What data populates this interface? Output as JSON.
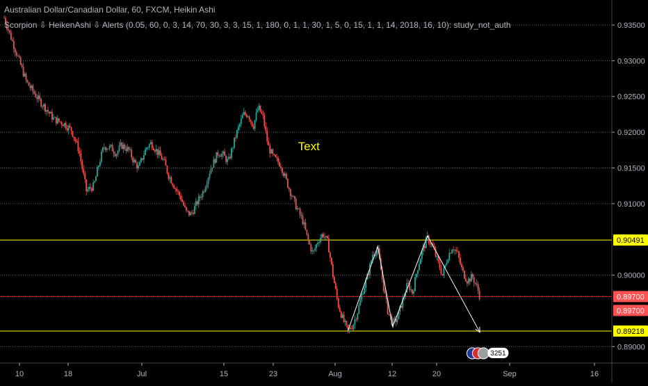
{
  "header": {
    "title": "Australian Dollar/Canadian Dollar, 60, FXCM, Heikin Ashi",
    "study": "Scorpion ⇩ HeikenAshi ⇩ Alerts (0.05, 60, 0, 3, 14, 70, 30, 3, 3, 15, 1, 180, 0, 1, 1, 30, 1, 5, 0, 15, 1, 1, 14, 2018, 16, 10): study_not_auth"
  },
  "colors": {
    "background": "#000000",
    "grid": "#5d606b",
    "axis_text": "#b2b5be",
    "candle_up": "#26a69a",
    "candle_down": "#ef5350",
    "level_yellow": "#ffff00",
    "level_red": "#ff5252",
    "annotation_text": "#ffff00",
    "pattern_line": "#ffffff"
  },
  "chart_data": {
    "type": "candlestick",
    "title": "Australian Dollar/Canadian Dollar, 60, FXCM, Heikin Ashi",
    "xlabel": "",
    "ylabel": "",
    "ylim": [
      0.8877,
      0.9385
    ],
    "y_ticks": [
      "0.93500",
      "0.93000",
      "0.92500",
      "0.92000",
      "0.91500",
      "0.91000",
      "0.90000",
      "0.89000"
    ],
    "x_tick_labels": [
      "10",
      "18",
      "Jul",
      "15",
      "23",
      "Aug",
      "12",
      "20",
      "Sep",
      "16"
    ],
    "grid": true,
    "price_series": [
      {
        "t": 0,
        "p": 0.936
      },
      {
        "t": 2,
        "p": 0.934
      },
      {
        "t": 6,
        "p": 0.93
      },
      {
        "t": 9,
        "p": 0.927
      },
      {
        "t": 12,
        "p": 0.9255
      },
      {
        "t": 14,
        "p": 0.9245
      },
      {
        "t": 17,
        "p": 0.9232
      },
      {
        "t": 20,
        "p": 0.9218
      },
      {
        "t": 24,
        "p": 0.9212
      },
      {
        "t": 27,
        "p": 0.9203
      },
      {
        "t": 30,
        "p": 0.9175
      },
      {
        "t": 33,
        "p": 0.9118
      },
      {
        "t": 36,
        "p": 0.9125
      },
      {
        "t": 38,
        "p": 0.9155
      },
      {
        "t": 40,
        "p": 0.918
      },
      {
        "t": 43,
        "p": 0.9178
      },
      {
        "t": 45,
        "p": 0.917
      },
      {
        "t": 47,
        "p": 0.9182
      },
      {
        "t": 50,
        "p": 0.9175
      },
      {
        "t": 52,
        "p": 0.916
      },
      {
        "t": 54,
        "p": 0.915
      },
      {
        "t": 57,
        "p": 0.9178
      },
      {
        "t": 59,
        "p": 0.9185
      },
      {
        "t": 61,
        "p": 0.9175
      },
      {
        "t": 64,
        "p": 0.916
      },
      {
        "t": 66,
        "p": 0.914
      },
      {
        "t": 69,
        "p": 0.912
      },
      {
        "t": 71,
        "p": 0.9108
      },
      {
        "t": 73,
        "p": 0.9088
      },
      {
        "t": 75,
        "p": 0.9085
      },
      {
        "t": 78,
        "p": 0.9105
      },
      {
        "t": 80,
        "p": 0.9118
      },
      {
        "t": 83,
        "p": 0.915
      },
      {
        "t": 86,
        "p": 0.9172
      },
      {
        "t": 88,
        "p": 0.9168
      },
      {
        "t": 90,
        "p": 0.9158
      },
      {
        "t": 93,
        "p": 0.9195
      },
      {
        "t": 96,
        "p": 0.9225
      },
      {
        "t": 98,
        "p": 0.9225
      },
      {
        "t": 100,
        "p": 0.9208
      },
      {
        "t": 102,
        "p": 0.9235
      },
      {
        "t": 104,
        "p": 0.922
      },
      {
        "t": 106,
        "p": 0.918
      },
      {
        "t": 108,
        "p": 0.9165
      },
      {
        "t": 111,
        "p": 0.9155
      },
      {
        "t": 114,
        "p": 0.9125
      },
      {
        "t": 117,
        "p": 0.9098
      },
      {
        "t": 120,
        "p": 0.9075
      },
      {
        "t": 122,
        "p": 0.9048
      },
      {
        "t": 124,
        "p": 0.903
      },
      {
        "t": 126,
        "p": 0.9048
      },
      {
        "t": 128,
        "p": 0.9058
      },
      {
        "t": 130,
        "p": 0.9045
      },
      {
        "t": 132,
        "p": 0.9
      },
      {
        "t": 134,
        "p": 0.896
      },
      {
        "t": 136,
        "p": 0.8938
      },
      {
        "t": 138,
        "p": 0.8922
      },
      {
        "t": 140,
        "p": 0.893
      },
      {
        "t": 142,
        "p": 0.895
      },
      {
        "t": 144,
        "p": 0.8978
      },
      {
        "t": 146,
        "p": 0.9
      },
      {
        "t": 148,
        "p": 0.903
      },
      {
        "t": 150,
        "p": 0.9036
      },
      {
        "t": 152,
        "p": 0.899
      },
      {
        "t": 154,
        "p": 0.895
      },
      {
        "t": 156,
        "p": 0.8932
      },
      {
        "t": 158,
        "p": 0.894
      },
      {
        "t": 160,
        "p": 0.8965
      },
      {
        "t": 162,
        "p": 0.8988
      },
      {
        "t": 164,
        "p": 0.8975
      },
      {
        "t": 166,
        "p": 0.901
      },
      {
        "t": 168,
        "p": 0.9035
      },
      {
        "t": 170,
        "p": 0.9052
      },
      {
        "t": 172,
        "p": 0.904
      },
      {
        "t": 174,
        "p": 0.902
      },
      {
        "t": 176,
        "p": 0.9
      },
      {
        "t": 178,
        "p": 0.9025
      },
      {
        "t": 180,
        "p": 0.904
      },
      {
        "t": 182,
        "p": 0.903
      },
      {
        "t": 184,
        "p": 0.9005
      },
      {
        "t": 186,
        "p": 0.8992
      },
      {
        "t": 188,
        "p": 0.8998
      },
      {
        "t": 190,
        "p": 0.8982
      },
      {
        "t": 191,
        "p": 0.897
      }
    ],
    "levels": [
      {
        "value": 0.90491,
        "label": "0.90491",
        "color": "#ffff00"
      },
      {
        "value": 0.897,
        "label": "0.89700",
        "color": "#ff5252"
      },
      {
        "value": 0.89218,
        "label": "0.89218",
        "color": "#ffff00"
      }
    ],
    "current_price_label": "0.89700",
    "annotations": [
      {
        "text": "Text",
        "t": 118,
        "p": 0.9175,
        "color": "#ffff00"
      }
    ],
    "pattern_lines": [
      [
        {
          "t": 138,
          "p": 0.8922
        },
        {
          "t": 150,
          "p": 0.904
        },
        {
          "t": 156,
          "p": 0.8928
        },
        {
          "t": 170,
          "p": 0.9055
        },
        {
          "t": 191,
          "p": 0.892
        }
      ]
    ],
    "bottom_badge": "3251"
  }
}
